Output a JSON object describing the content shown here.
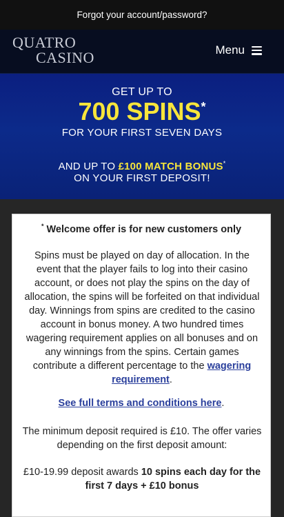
{
  "topbar": {
    "forgot_link": "Forgot your account/password?"
  },
  "header": {
    "logo_line1": "QUATRO",
    "logo_line2": "CASINO",
    "menu_label": "Menu"
  },
  "banner": {
    "line1": "GET UP TO",
    "spins": "700 SPINS",
    "spins_star": "*",
    "line3": "FOR YOUR FIRST SEVEN DAYS",
    "line4_prefix": "AND UP TO ",
    "line4_bonus": "£100 MATCH BONUS",
    "line4_star": "*",
    "line5": "ON YOUR FIRST DEPOSIT!"
  },
  "offer": {
    "title_star": "*",
    "title": " Welcome offer is for new customers only",
    "body": "Spins must be played on day of allocation. In the event that the player fails to log into their casino account, or does not play the spins on the day of allocation, the spins will be forfeited on that individual day. Winnings from spins are credited to the casino account in bonus money. A two hundred times wagering requirement applies on all bonuses and on any winnings from the spins. Certain games contribute a different percentage to the ",
    "wagering_link": "wagering requirement",
    "body_end": ".",
    "terms_link": "See full terms and conditions here",
    "terms_end": ".",
    "min_deposit": "The minimum deposit required is £10. The offer varies depending on the first deposit amount:",
    "tier_prefix": "£10-19.99 deposit awards ",
    "tier_bold": "10 spins each day for the first 7 days + £10 bonus"
  },
  "colors": {
    "banner_blue": "#0c2a8a",
    "accent_yellow": "#f7e53b",
    "link_blue": "#2a3f9c"
  }
}
